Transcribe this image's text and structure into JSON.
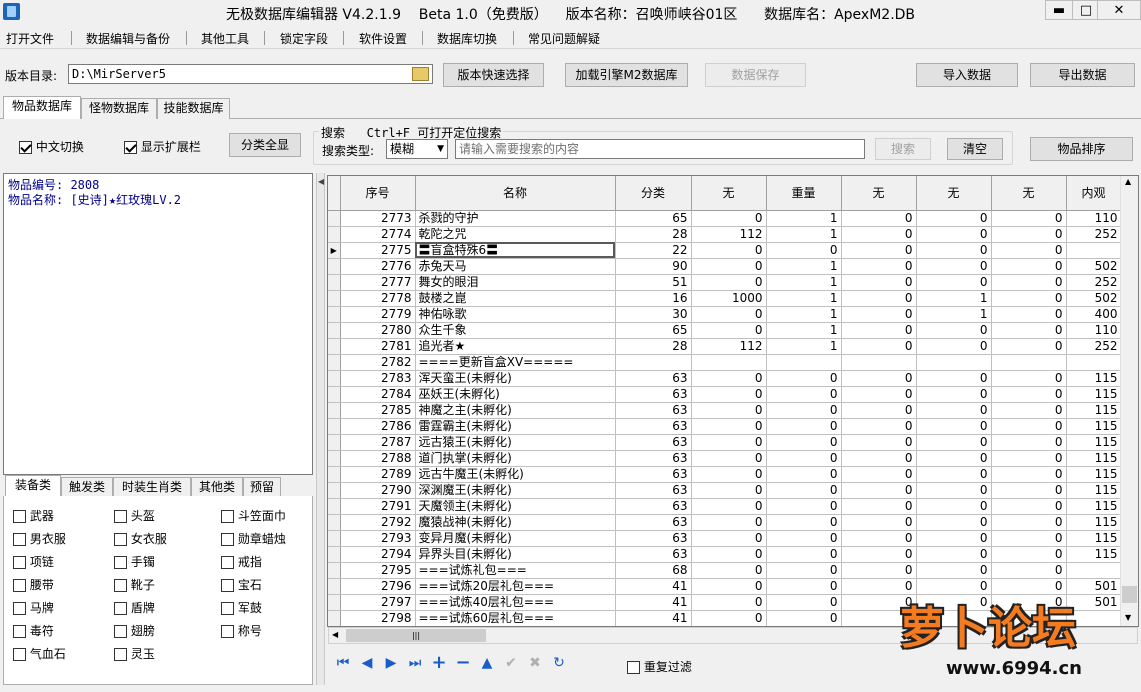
{
  "window": {
    "title": "无极数据库编辑器 V4.2.1.9    Beta 1.0（免费版）    版本名称：召唤师峡谷01区      数据库名：ApexM2.DB",
    "minimize": "▬",
    "maximize": "□",
    "close": "✕"
  },
  "menu": [
    "打开文件",
    "数据编辑与备份",
    "其他工具",
    "锁定字段",
    "软件设置",
    "数据库切换",
    "常见问题解疑"
  ],
  "toolbar": {
    "dir_label": "版本目录:",
    "dir_value": "D:\\MirServer5",
    "quick_select": "版本快速选择",
    "load_engine": "加载引擎M2数据库",
    "save_data": "数据保存",
    "import_data": "导入数据",
    "export_data": "导出数据"
  },
  "tabs": [
    "物品数据库",
    "怪物数据库",
    "技能数据库"
  ],
  "filters": {
    "chinese_switch": "中文切换",
    "chinese_switch_checked": true,
    "show_ext": "显示扩展栏",
    "show_ext_checked": true,
    "category_all": "分类全显",
    "search_title": "搜索   Ctrl+F 可打开定位搜索",
    "search_type_label": "搜索类型:",
    "search_type_value": "模糊",
    "search_placeholder": "请输入需要搜索的内容",
    "search_button": "搜索",
    "clear_button": "清空",
    "sort_button": "物品排序"
  },
  "item_info": {
    "id_line": "物品编号: 2808",
    "name_line": "物品名称: [史诗]★红玫瑰LV.2"
  },
  "category_tabs": [
    "装备类",
    "触发类",
    "时装生肖类",
    "其他类",
    "预留"
  ],
  "categories": [
    [
      "武器",
      "头盔",
      "斗笠面巾"
    ],
    [
      "男衣服",
      "女衣服",
      "勋章蜡烛"
    ],
    [
      "项链",
      "手镯",
      "戒指"
    ],
    [
      "腰带",
      "靴子",
      "宝石"
    ],
    [
      "马牌",
      "盾牌",
      "军鼓"
    ],
    [
      "毒符",
      "翅膀",
      "称号"
    ],
    [
      "气血石",
      "灵玉",
      ""
    ]
  ],
  "grid": {
    "columns": [
      "序号",
      "名称",
      "分类",
      "无",
      "重量",
      "无",
      "无",
      "无",
      "内观"
    ],
    "current_row": 2,
    "rows": [
      [
        "2773",
        "杀戮的守护",
        "65",
        "0",
        "1",
        "0",
        "0",
        "0",
        "110"
      ],
      [
        "2774",
        "乾陀之咒",
        "28",
        "112",
        "1",
        "0",
        "0",
        "0",
        "252"
      ],
      [
        "2775",
        "〓盲盒特殊6〓",
        "22",
        "0",
        "0",
        "0",
        "0",
        "0",
        ""
      ],
      [
        "2776",
        "赤兔天马",
        "90",
        "0",
        "1",
        "0",
        "0",
        "0",
        "502"
      ],
      [
        "2777",
        "舞女的眼泪",
        "51",
        "0",
        "1",
        "0",
        "0",
        "0",
        "252"
      ],
      [
        "2778",
        "鼓楼之崑",
        "16",
        "1000",
        "1",
        "0",
        "1",
        "0",
        "502"
      ],
      [
        "2779",
        "神佑咏歌",
        "30",
        "0",
        "1",
        "0",
        "1",
        "0",
        "400"
      ],
      [
        "2780",
        "众生千象",
        "65",
        "0",
        "1",
        "0",
        "0",
        "0",
        "110"
      ],
      [
        "2781",
        "追光者★",
        "28",
        "112",
        "1",
        "0",
        "0",
        "0",
        "252"
      ],
      [
        "2782",
        "====更新盲盒XV=====",
        "",
        "",
        "",
        "",
        "",
        "",
        ""
      ],
      [
        "2783",
        "浑天蛮王(未孵化)",
        "63",
        "0",
        "0",
        "0",
        "0",
        "0",
        "115"
      ],
      [
        "2784",
        "巫妖王(未孵化)",
        "63",
        "0",
        "0",
        "0",
        "0",
        "0",
        "115"
      ],
      [
        "2785",
        "神魔之主(未孵化)",
        "63",
        "0",
        "0",
        "0",
        "0",
        "0",
        "115"
      ],
      [
        "2786",
        "雷霆霸主(未孵化)",
        "63",
        "0",
        "0",
        "0",
        "0",
        "0",
        "115"
      ],
      [
        "2787",
        "远古猿王(未孵化)",
        "63",
        "0",
        "0",
        "0",
        "0",
        "0",
        "115"
      ],
      [
        "2788",
        "道门执掌(未孵化)",
        "63",
        "0",
        "0",
        "0",
        "0",
        "0",
        "115"
      ],
      [
        "2789",
        "远古牛魔王(未孵化)",
        "63",
        "0",
        "0",
        "0",
        "0",
        "0",
        "115"
      ],
      [
        "2790",
        "深渊魔王(未孵化)",
        "63",
        "0",
        "0",
        "0",
        "0",
        "0",
        "115"
      ],
      [
        "2791",
        "天魔领主(未孵化)",
        "63",
        "0",
        "0",
        "0",
        "0",
        "0",
        "115"
      ],
      [
        "2792",
        "魔猿战神(未孵化)",
        "63",
        "0",
        "0",
        "0",
        "0",
        "0",
        "115"
      ],
      [
        "2793",
        "变异月魔(未孵化)",
        "63",
        "0",
        "0",
        "0",
        "0",
        "0",
        "115"
      ],
      [
        "2794",
        "异界头目(未孵化)",
        "63",
        "0",
        "0",
        "0",
        "0",
        "0",
        "115"
      ],
      [
        "2795",
        "===试炼礼包===",
        "68",
        "0",
        "0",
        "0",
        "0",
        "0",
        ""
      ],
      [
        "2796",
        "===试炼20层礼包===",
        "41",
        "0",
        "0",
        "0",
        "0",
        "0",
        "501"
      ],
      [
        "2797",
        "===试炼40层礼包===",
        "41",
        "0",
        "0",
        "0",
        "0",
        "0",
        "501"
      ],
      [
        "2798",
        "===试炼60层礼包===",
        "41",
        "0",
        "0",
        "0",
        "",
        "",
        ""
      ]
    ]
  },
  "navigator": {
    "buttons": [
      "first",
      "prior",
      "next",
      "last",
      "insert",
      "delete",
      "edit",
      "post",
      "cancel",
      "refresh"
    ],
    "glyphs": [
      "⏮",
      "◀",
      "▶",
      "⏭",
      "+",
      "−",
      "▲",
      "✔",
      "✖",
      "↻"
    ],
    "repeat_filter": "重复过滤",
    "repeat_filter_checked": false
  },
  "watermark": {
    "text": "萝卜论坛",
    "url": "www.6994.cn"
  },
  "colors": {
    "info_text": "#00008b",
    "nav_icon": "#1a5dc8",
    "watermark_orange": "#f47b20"
  }
}
